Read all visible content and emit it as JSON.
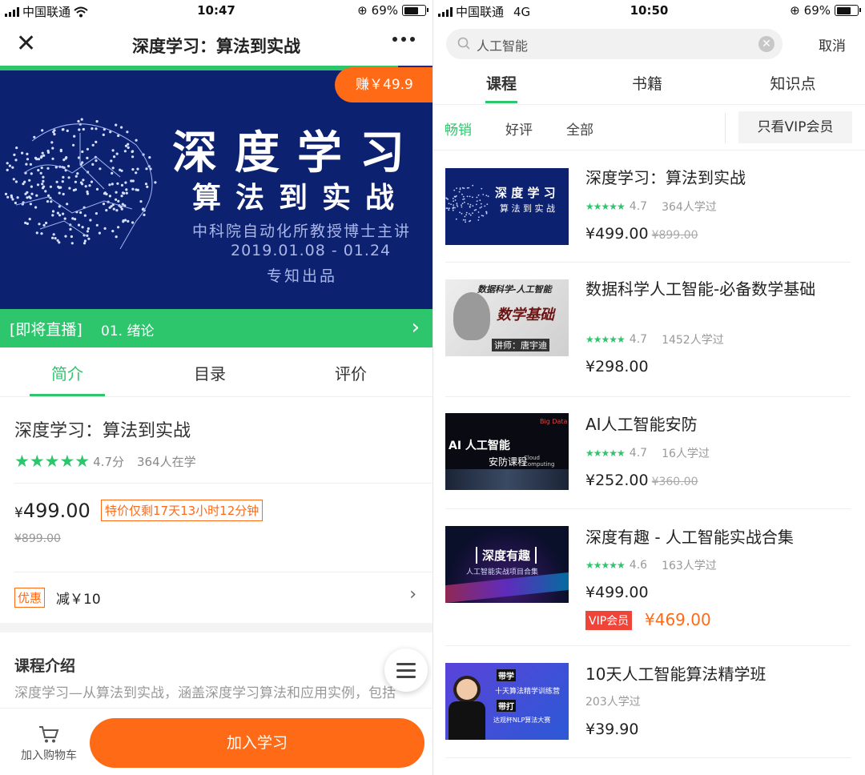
{
  "left": {
    "status": {
      "carrier": "中国联通",
      "time": "10:47",
      "battery": "69%"
    },
    "nav": {
      "title": "深度学习：算法到实战"
    },
    "banner": {
      "title": "深度学习",
      "subtitle": "算法到实战",
      "line1": "中科院自动化所教授博士主讲",
      "line2": "2019.01.08 - 01.24",
      "line3": "专知出品",
      "earn": "赚￥49.9"
    },
    "live": {
      "tag": "[即将直播]",
      "lesson": "01. 绪论"
    },
    "tabs": [
      "简介",
      "目录",
      "评价"
    ],
    "course": {
      "title": "深度学习：算法到实战",
      "rating": "4.7分",
      "learners": "364人在学",
      "price_symbol": "¥",
      "price": "499.00",
      "deal": "特价仅剩17天13小时12分钟",
      "old_price": "¥899.00",
      "coupon_tag": "优惠",
      "coupon_text": "减￥10"
    },
    "intro": {
      "heading": "课程介绍",
      "text": "深度学习—从算法到实战，涵盖深度学习算法和应用实例，包括计算机视觉的目标检测、图像生成、自然语言处理的文本良"
    },
    "bottom": {
      "cart": "加入购物车",
      "join": "加入学习"
    }
  },
  "right": {
    "status": {
      "carrier": "中国联通",
      "network": "4G",
      "time": "10:50",
      "battery": "69%"
    },
    "search": {
      "value": "人工智能",
      "cancel": "取消"
    },
    "tabs": [
      "课程",
      "书籍",
      "知识点"
    ],
    "filters": [
      "畅销",
      "好评",
      "全部"
    ],
    "vip_filter": "只看VIP会员",
    "items": [
      {
        "title": "深度学习：算法到实战",
        "rating": "4.7",
        "learners": "364人学过",
        "price": "¥499.00",
        "old_price": "¥899.00",
        "thumb_t1": "深 度 学 习",
        "thumb_t2": "算 法 到 实 战"
      },
      {
        "title": "数据科学人工智能-必备数学基础",
        "rating": "4.7",
        "learners": "1452人学过",
        "price": "¥298.00",
        "thumb_t1": "数据科学-人工智能",
        "thumb_t2": "数学基础",
        "thumb_t3": "讲师：唐宇迪"
      },
      {
        "title": "AI人工智能安防",
        "rating": "4.7",
        "learners": "16人学过",
        "price": "¥252.00",
        "old_price": "¥360.00",
        "thumb_t1": "AI 人工智能",
        "thumb_t2": "安防课程",
        "thumb_t3": "Big Data",
        "thumb_t4": "Cloud Computing"
      },
      {
        "title": "深度有趣 - 人工智能实战合集",
        "rating": "4.6",
        "learners": "163人学过",
        "price": "¥499.00",
        "vip_tag": "VIP会员",
        "vip_price": "¥469.00",
        "thumb_t1": "深度有趣",
        "thumb_t2": "人工智能实战项目合集"
      },
      {
        "title": "10天人工智能算法精学班",
        "learners": "203人学过",
        "price": "¥39.90",
        "thumb_t1": "带学",
        "thumb_t2": "十天算法精学训练营",
        "thumb_t3": "带打",
        "thumb_t4": "达观杯NLP算法大赛"
      }
    ]
  }
}
